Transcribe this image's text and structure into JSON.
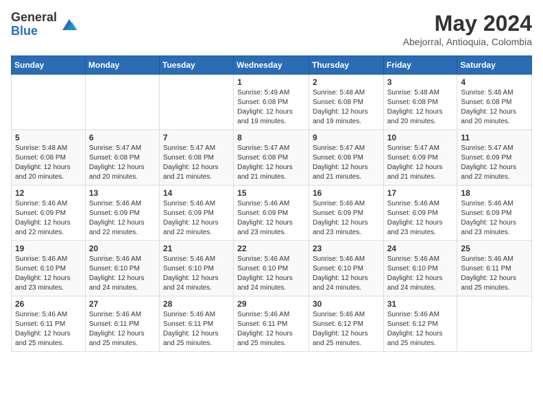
{
  "logo": {
    "general": "General",
    "blue": "Blue"
  },
  "header": {
    "month_year": "May 2024",
    "location": "Abejorral, Antioquia, Colombia"
  },
  "days_of_week": [
    "Sunday",
    "Monday",
    "Tuesday",
    "Wednesday",
    "Thursday",
    "Friday",
    "Saturday"
  ],
  "weeks": [
    {
      "days": [
        {
          "num": "",
          "info": ""
        },
        {
          "num": "",
          "info": ""
        },
        {
          "num": "",
          "info": ""
        },
        {
          "num": "1",
          "info": "Sunrise: 5:49 AM\nSunset: 6:08 PM\nDaylight: 12 hours\nand 19 minutes."
        },
        {
          "num": "2",
          "info": "Sunrise: 5:48 AM\nSunset: 6:08 PM\nDaylight: 12 hours\nand 19 minutes."
        },
        {
          "num": "3",
          "info": "Sunrise: 5:48 AM\nSunset: 6:08 PM\nDaylight: 12 hours\nand 20 minutes."
        },
        {
          "num": "4",
          "info": "Sunrise: 5:48 AM\nSunset: 6:08 PM\nDaylight: 12 hours\nand 20 minutes."
        }
      ]
    },
    {
      "days": [
        {
          "num": "5",
          "info": "Sunrise: 5:48 AM\nSunset: 6:08 PM\nDaylight: 12 hours\nand 20 minutes."
        },
        {
          "num": "6",
          "info": "Sunrise: 5:47 AM\nSunset: 6:08 PM\nDaylight: 12 hours\nand 20 minutes."
        },
        {
          "num": "7",
          "info": "Sunrise: 5:47 AM\nSunset: 6:08 PM\nDaylight: 12 hours\nand 21 minutes."
        },
        {
          "num": "8",
          "info": "Sunrise: 5:47 AM\nSunset: 6:08 PM\nDaylight: 12 hours\nand 21 minutes."
        },
        {
          "num": "9",
          "info": "Sunrise: 5:47 AM\nSunset: 6:08 PM\nDaylight: 12 hours\nand 21 minutes."
        },
        {
          "num": "10",
          "info": "Sunrise: 5:47 AM\nSunset: 6:09 PM\nDaylight: 12 hours\nand 21 minutes."
        },
        {
          "num": "11",
          "info": "Sunrise: 5:47 AM\nSunset: 6:09 PM\nDaylight: 12 hours\nand 22 minutes."
        }
      ]
    },
    {
      "days": [
        {
          "num": "12",
          "info": "Sunrise: 5:46 AM\nSunset: 6:09 PM\nDaylight: 12 hours\nand 22 minutes."
        },
        {
          "num": "13",
          "info": "Sunrise: 5:46 AM\nSunset: 6:09 PM\nDaylight: 12 hours\nand 22 minutes."
        },
        {
          "num": "14",
          "info": "Sunrise: 5:46 AM\nSunset: 6:09 PM\nDaylight: 12 hours\nand 22 minutes."
        },
        {
          "num": "15",
          "info": "Sunrise: 5:46 AM\nSunset: 6:09 PM\nDaylight: 12 hours\nand 23 minutes."
        },
        {
          "num": "16",
          "info": "Sunrise: 5:46 AM\nSunset: 6:09 PM\nDaylight: 12 hours\nand 23 minutes."
        },
        {
          "num": "17",
          "info": "Sunrise: 5:46 AM\nSunset: 6:09 PM\nDaylight: 12 hours\nand 23 minutes."
        },
        {
          "num": "18",
          "info": "Sunrise: 5:46 AM\nSunset: 6:09 PM\nDaylight: 12 hours\nand 23 minutes."
        }
      ]
    },
    {
      "days": [
        {
          "num": "19",
          "info": "Sunrise: 5:46 AM\nSunset: 6:10 PM\nDaylight: 12 hours\nand 23 minutes."
        },
        {
          "num": "20",
          "info": "Sunrise: 5:46 AM\nSunset: 6:10 PM\nDaylight: 12 hours\nand 24 minutes."
        },
        {
          "num": "21",
          "info": "Sunrise: 5:46 AM\nSunset: 6:10 PM\nDaylight: 12 hours\nand 24 minutes."
        },
        {
          "num": "22",
          "info": "Sunrise: 5:46 AM\nSunset: 6:10 PM\nDaylight: 12 hours\nand 24 minutes."
        },
        {
          "num": "23",
          "info": "Sunrise: 5:46 AM\nSunset: 6:10 PM\nDaylight: 12 hours\nand 24 minutes."
        },
        {
          "num": "24",
          "info": "Sunrise: 5:46 AM\nSunset: 6:10 PM\nDaylight: 12 hours\nand 24 minutes."
        },
        {
          "num": "25",
          "info": "Sunrise: 5:46 AM\nSunset: 6:11 PM\nDaylight: 12 hours\nand 25 minutes."
        }
      ]
    },
    {
      "days": [
        {
          "num": "26",
          "info": "Sunrise: 5:46 AM\nSunset: 6:11 PM\nDaylight: 12 hours\nand 25 minutes."
        },
        {
          "num": "27",
          "info": "Sunrise: 5:46 AM\nSunset: 6:11 PM\nDaylight: 12 hours\nand 25 minutes."
        },
        {
          "num": "28",
          "info": "Sunrise: 5:46 AM\nSunset: 6:11 PM\nDaylight: 12 hours\nand 25 minutes."
        },
        {
          "num": "29",
          "info": "Sunrise: 5:46 AM\nSunset: 6:11 PM\nDaylight: 12 hours\nand 25 minutes."
        },
        {
          "num": "30",
          "info": "Sunrise: 5:46 AM\nSunset: 6:12 PM\nDaylight: 12 hours\nand 25 minutes."
        },
        {
          "num": "31",
          "info": "Sunrise: 5:46 AM\nSunset: 6:12 PM\nDaylight: 12 hours\nand 25 minutes."
        },
        {
          "num": "",
          "info": ""
        }
      ]
    }
  ]
}
